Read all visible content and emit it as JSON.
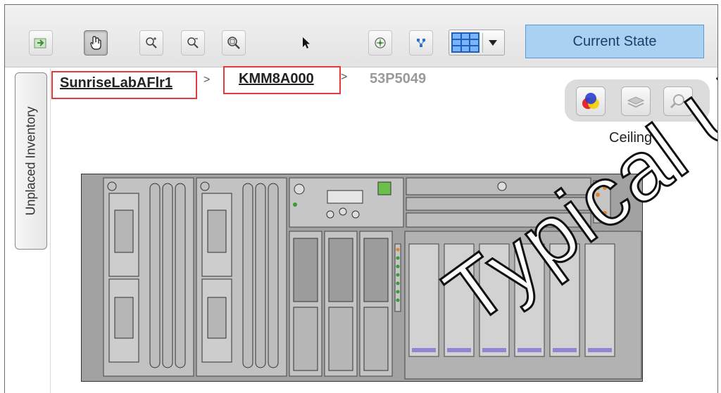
{
  "toolbar": {
    "buttons": [
      {
        "name": "export-button",
        "icon": "export-icon"
      },
      {
        "name": "pan-button",
        "icon": "hand-icon"
      },
      {
        "name": "zoom-in-button",
        "icon": "zoom-in-icon"
      },
      {
        "name": "zoom-out-button",
        "icon": "zoom-out-icon"
      },
      {
        "name": "zoom-fit-button",
        "icon": "zoom-fit-icon"
      },
      {
        "name": "select-button",
        "icon": "pointer-arrow-icon"
      },
      {
        "name": "navigate-button",
        "icon": "compass-icon"
      },
      {
        "name": "layout-button",
        "icon": "network-icon"
      }
    ],
    "grid_view_icon": "grid-view-icon",
    "current_state_label": "Current State"
  },
  "side_tab": {
    "label": "Unplaced Inventory"
  },
  "breadcrumb": {
    "items": [
      "SunriseLabAFlr1",
      "KMM8A000",
      "53P5049"
    ],
    "separator": ">"
  },
  "ceiling": {
    "label": "Ceiling",
    "buttons": [
      "color-layers-icon",
      "layers-icon",
      "magnifier-icon"
    ]
  },
  "colors": {
    "accent_button": "#a9d2f2",
    "breadcrumb_highlight": "#e23b3b",
    "grid_icon": "#1f5fb5"
  },
  "watermark": {
    "text": "Typical Use"
  }
}
